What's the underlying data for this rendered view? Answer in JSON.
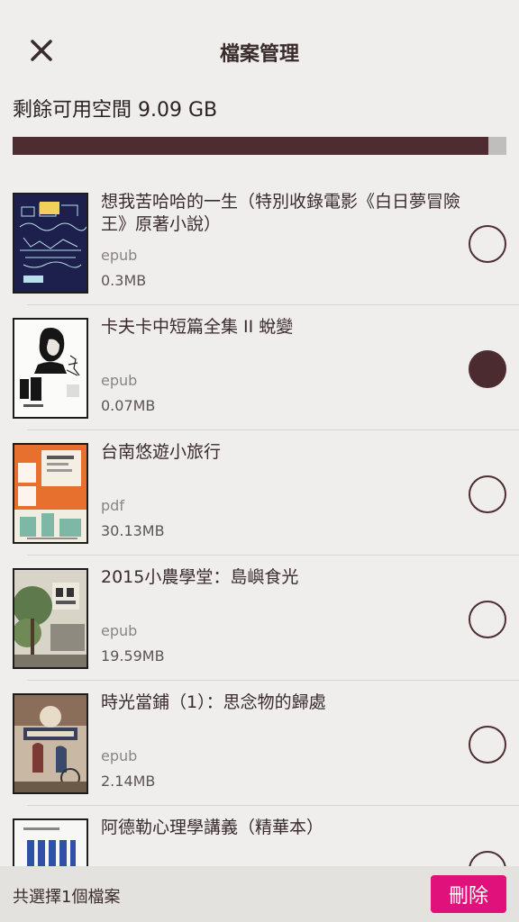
{
  "header": {
    "title": "檔案管理",
    "close_icon": "close-icon"
  },
  "storage": {
    "label": "剩餘可用空間 9.09 GB",
    "used_fraction": 0.964
  },
  "files": [
    {
      "title": "想我苦哈哈的一生（特別收錄電影《白日夢冒險王》原著小說）",
      "format": "epub",
      "size": "0.3MB",
      "selected": false
    },
    {
      "title": "卡夫卡中短篇全集 II 蛻變",
      "format": "epub",
      "size": "0.07MB",
      "selected": true
    },
    {
      "title": "台南悠遊小旅行",
      "format": "pdf",
      "size": "30.13MB",
      "selected": false
    },
    {
      "title": "2015小農學堂：島嶼食光",
      "format": "epub",
      "size": "19.59MB",
      "selected": false
    },
    {
      "title": "時光當鋪（1）：思念物的歸處",
      "format": "epub",
      "size": "2.14MB",
      "selected": false
    },
    {
      "title": "阿德勒心理學講義（精華本）",
      "format": "",
      "size": "",
      "selected": false
    }
  ],
  "footer": {
    "selection_text": "共選擇1個檔案",
    "delete_label": "刪除"
  },
  "colors": {
    "accent": "#4b2b2f",
    "delete": "#e0117a",
    "background": "#efeeec"
  }
}
